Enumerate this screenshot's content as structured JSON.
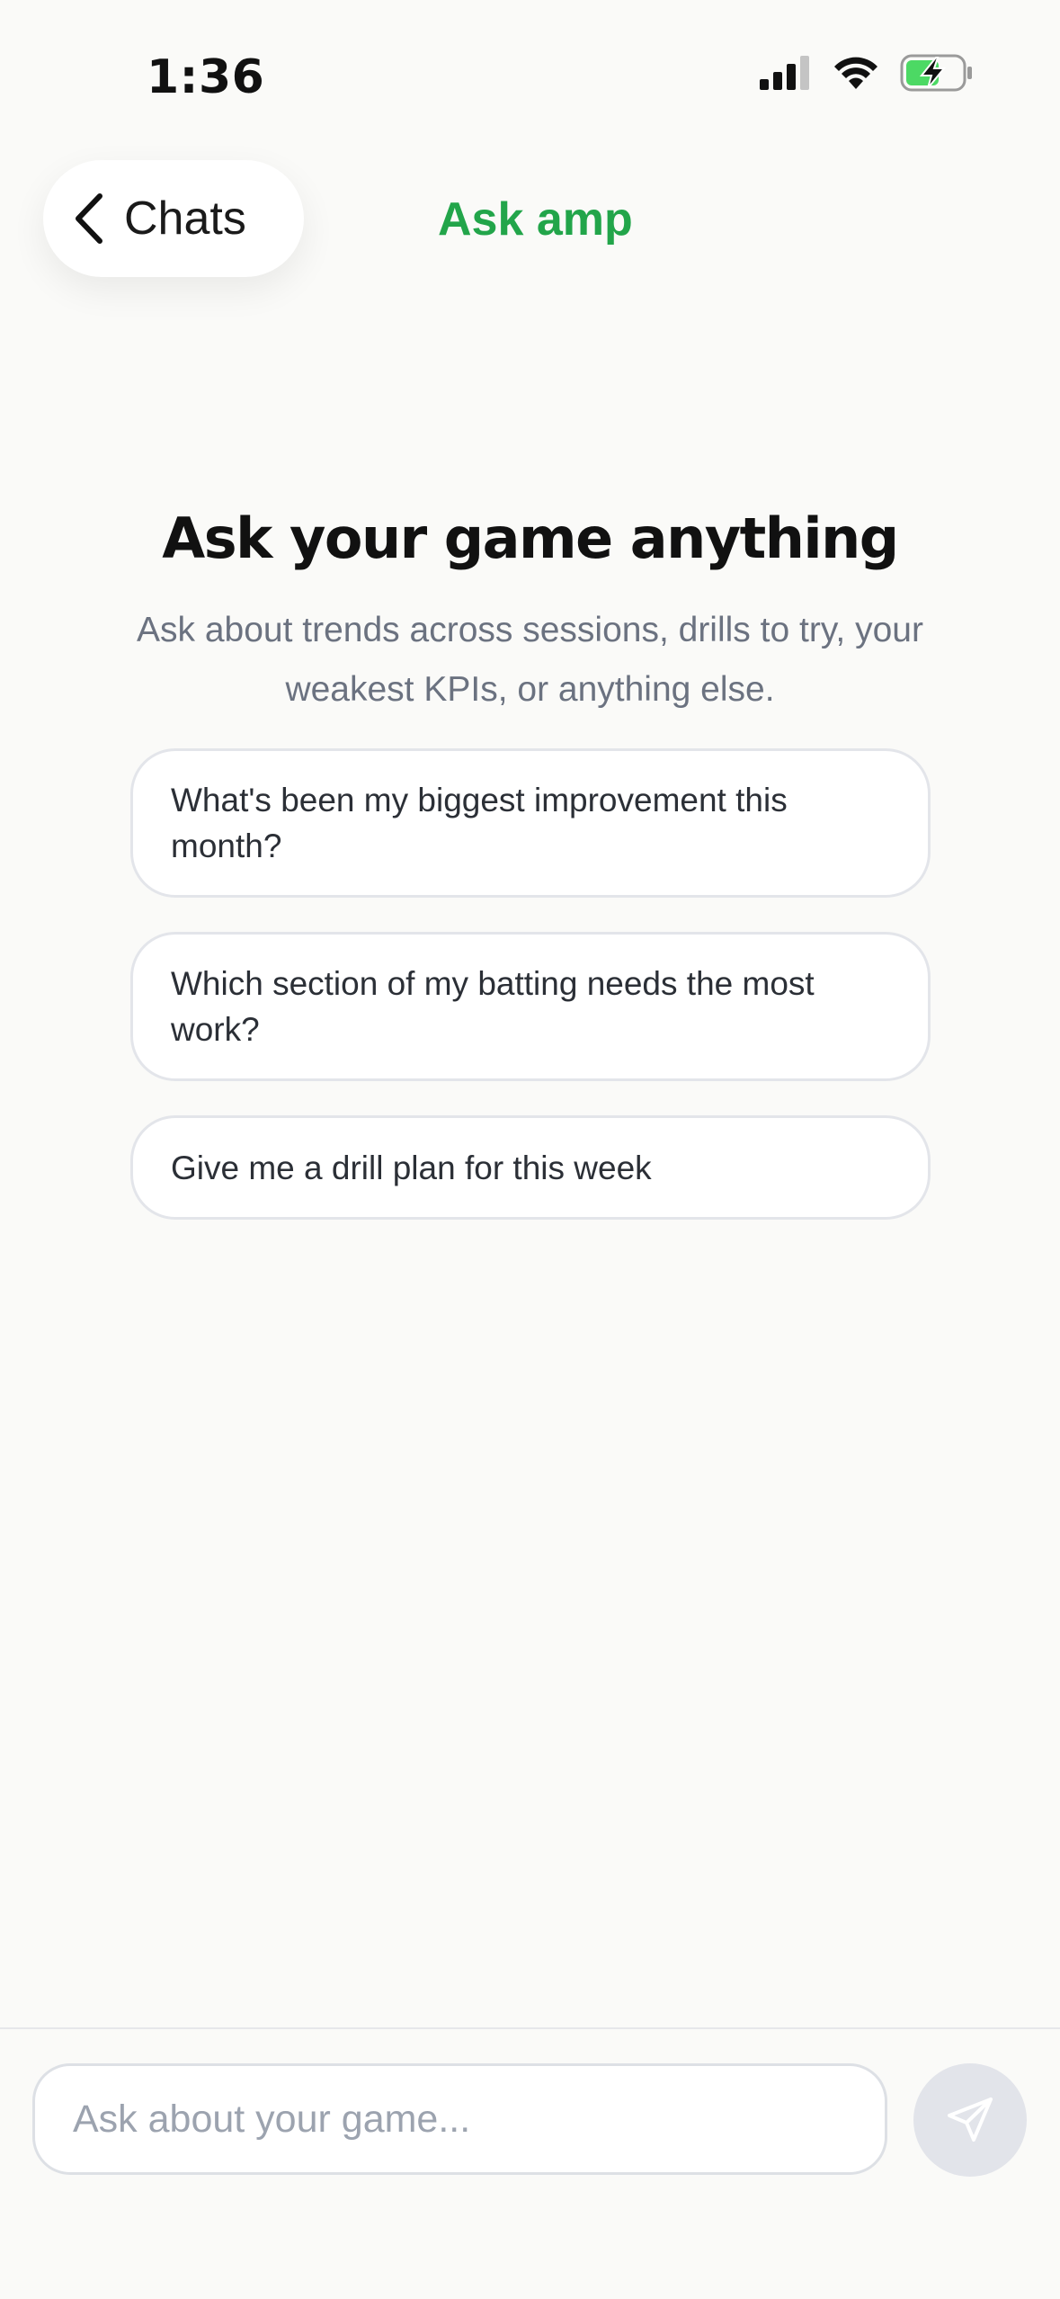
{
  "status_bar": {
    "time": "1:36"
  },
  "header": {
    "back_label": "Chats",
    "title": "Ask amp"
  },
  "main": {
    "heading": "Ask your game anything",
    "subheading": "Ask about trends across sessions, drills to try, your weakest KPIs, or anything else.",
    "suggestions": [
      "What's been my biggest improvement this month?",
      "Which section of my batting needs the most work?",
      "Give me a drill plan for this week"
    ]
  },
  "composer": {
    "placeholder": "Ask about your game..."
  },
  "colors": {
    "accent": "#22a54a",
    "background": "#fafaf8",
    "battery_fill": "#4cd964"
  },
  "icons": [
    "cellular-signal-icon",
    "wifi-icon",
    "battery-charging-icon",
    "chevron-left-icon",
    "send-icon"
  ]
}
